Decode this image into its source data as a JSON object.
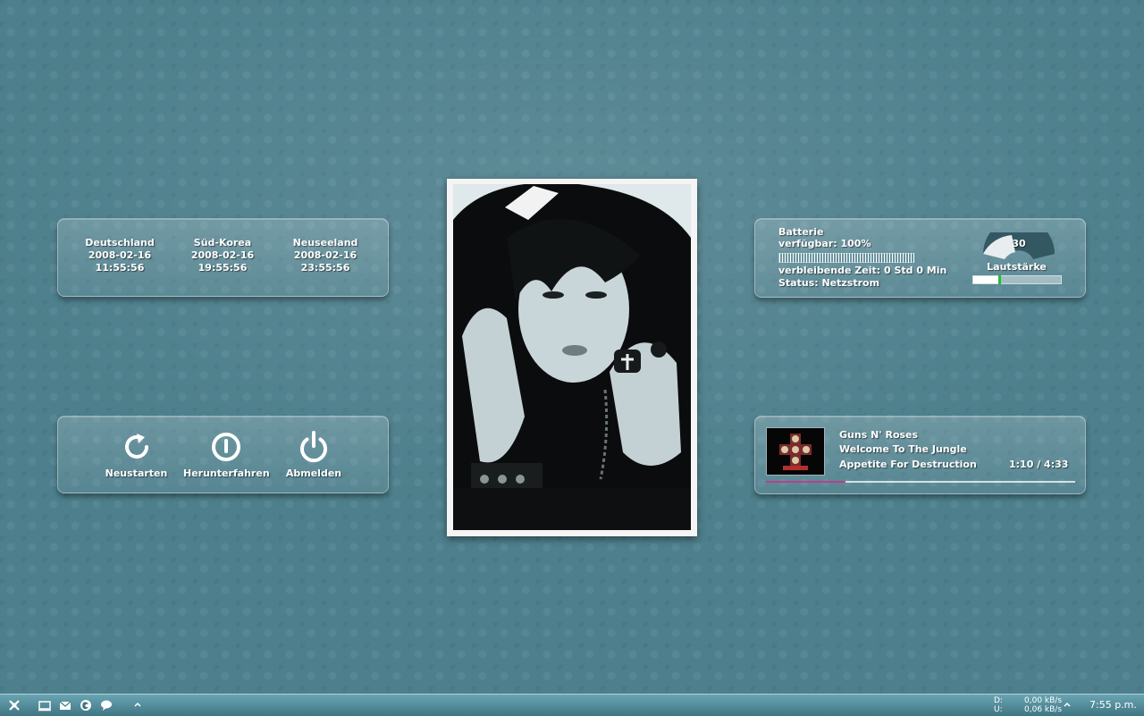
{
  "world_clock": {
    "locations": [
      {
        "name": "Deutschland",
        "date": "2008-02-16",
        "time": "11:55:56"
      },
      {
        "name": "Süd-Korea",
        "date": "2008-02-16",
        "time": "19:55:56"
      },
      {
        "name": "Neuseeland",
        "date": "2008-02-16",
        "time": "23:55:56"
      }
    ]
  },
  "power": {
    "buttons": [
      {
        "label": "Neustarten",
        "icon": "restart-icon"
      },
      {
        "label": "Herunterfahren",
        "icon": "shutdown-icon"
      },
      {
        "label": "Abmelden",
        "icon": "logoff-icon"
      }
    ]
  },
  "battery": {
    "title": "Batterie",
    "available": "verfügbar: 100%",
    "available_fraction": 1.0,
    "remaining": "verbleibende Zeit: 0 Std 0 Min",
    "status": "Status: Netzstrom"
  },
  "volume": {
    "value": "30",
    "label": "Lautstärke",
    "fraction": 0.3
  },
  "music": {
    "artist": "Guns N' Roses",
    "track": "Welcome To The Jungle",
    "album": "Appetite For Destruction",
    "time": "1:10 / 4:33",
    "progress_fraction": 0.256
  },
  "taskbar": {
    "icons": [
      "start-icon",
      "show-desktop-icon",
      "mail-icon",
      "firefox-icon",
      "chat-icon",
      "chevron-up-icon"
    ],
    "net_down_label": "D:",
    "net_down": "0,00 kB/s",
    "net_up_label": "U:",
    "net_up": "0,06 kB/s",
    "clock": "7:55 p.m."
  },
  "colors": {
    "desktop": "#4d7f8c",
    "progress": "#b8408f",
    "volume_knob": "#1fbe30"
  }
}
